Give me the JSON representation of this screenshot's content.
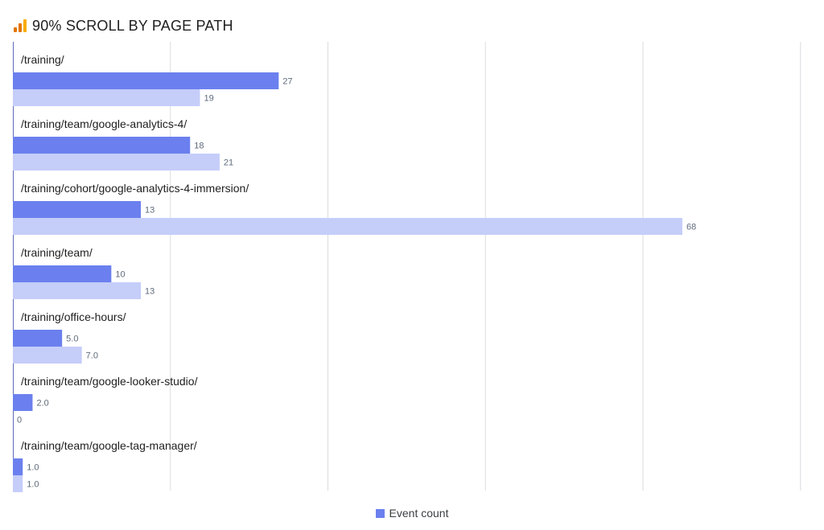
{
  "header": {
    "title": "90% SCROLL BY PAGE PATH",
    "icon": "analytics-bar-icon",
    "icon_colors": [
      "#F9AB00",
      "#E37400"
    ]
  },
  "legend": {
    "items": [
      {
        "label": "Event count",
        "color": "#6B80EE"
      }
    ]
  },
  "chart_data": {
    "type": "bar",
    "orientation": "horizontal",
    "categories": [
      "/training/",
      "/training/team/google-analytics-4/",
      "/training/cohort/google-analytics-4-immersion/",
      "/training/team/",
      "/training/office-hours/",
      "/training/team/google-looker-studio/",
      "/training/team/google-tag-manager/"
    ],
    "series": [
      {
        "name": "Event count",
        "color": "#6B80EE",
        "values": [
          27,
          18,
          13,
          10,
          5,
          2,
          1
        ],
        "labels": [
          "27",
          "18",
          "13",
          "10",
          "5.0",
          "2.0",
          "1.0"
        ]
      },
      {
        "color": "#C5CDF9",
        "values": [
          19,
          21,
          68,
          13,
          7,
          0,
          1
        ],
        "labels": [
          "19",
          "21",
          "68",
          "13",
          "7.0",
          "0",
          "1.0"
        ]
      }
    ],
    "xlim": [
      0,
      80
    ],
    "grid": true,
    "legend_position": "bottom"
  }
}
